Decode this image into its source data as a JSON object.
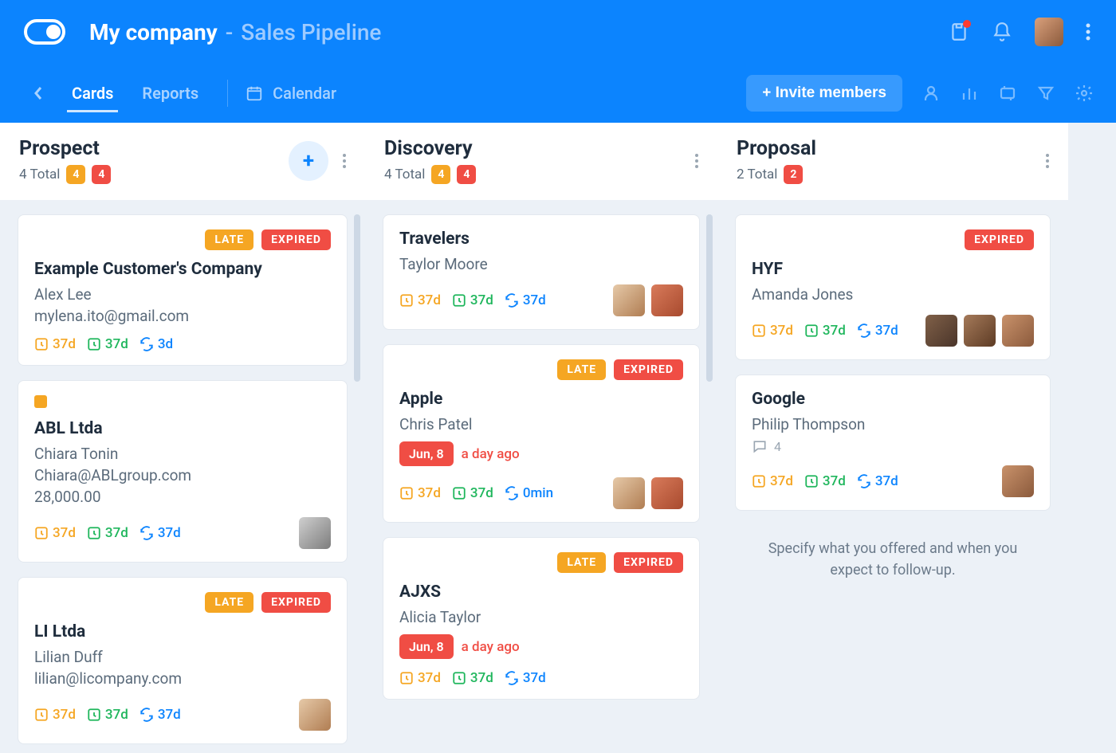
{
  "header": {
    "company": "My company",
    "page": "Sales Pipeline"
  },
  "tabs": {
    "cards": "Cards",
    "reports": "Reports",
    "calendar": "Calendar"
  },
  "invite_label": "+ Invite members",
  "columns": [
    {
      "title": "Prospect",
      "total_label": "4 Total",
      "badges": [
        "4",
        "4"
      ],
      "has_add": true,
      "scroll_hint": true,
      "cards": [
        {
          "status": [
            "LATE",
            "EXPIRED"
          ],
          "title": "Example Customer's Company",
          "lines": [
            "Alex Lee",
            "mylena.ito@gmail.com"
          ],
          "timers": [
            {
              "color": "orange",
              "v": "37d"
            },
            {
              "color": "green",
              "v": "37d"
            },
            {
              "color": "blue",
              "v": "3d"
            }
          ],
          "avatars": []
        },
        {
          "small_box": true,
          "title": "ABL Ltda",
          "lines": [
            "Chiara Tonin",
            "Chiara@ABLgroup.com",
            "28,000.00"
          ],
          "timers": [
            {
              "color": "orange",
              "v": "37d"
            },
            {
              "color": "green",
              "v": "37d"
            },
            {
              "color": "blue",
              "v": "37d"
            }
          ],
          "avatars": [
            "av-3"
          ]
        },
        {
          "status": [
            "LATE",
            "EXPIRED"
          ],
          "title": "LI Ltda",
          "lines": [
            "Lilian Duff",
            "lilian@licompany.com"
          ],
          "timers": [
            {
              "color": "orange",
              "v": "37d"
            },
            {
              "color": "green",
              "v": "37d"
            },
            {
              "color": "blue",
              "v": "37d"
            }
          ],
          "avatars": [
            "av-1"
          ]
        }
      ]
    },
    {
      "title": "Discovery",
      "total_label": "4 Total",
      "badges": [
        "4",
        "4"
      ],
      "scroll_hint": true,
      "cards": [
        {
          "title": "Travelers",
          "lines": [
            "Taylor Moore"
          ],
          "timers": [
            {
              "color": "orange",
              "v": "37d"
            },
            {
              "color": "green",
              "v": "37d"
            },
            {
              "color": "blue",
              "v": "37d"
            }
          ],
          "avatars": [
            "av-1",
            "av-2"
          ]
        },
        {
          "status": [
            "LATE",
            "EXPIRED"
          ],
          "title": "Apple",
          "lines": [
            "Chris Patel"
          ],
          "date_chip": "Jun, 8",
          "date_ago": "a day ago",
          "timers": [
            {
              "color": "orange",
              "v": "37d"
            },
            {
              "color": "green",
              "v": "37d"
            },
            {
              "color": "blue",
              "v": "0min"
            }
          ],
          "avatars": [
            "av-1",
            "av-2"
          ]
        },
        {
          "status": [
            "LATE",
            "EXPIRED"
          ],
          "title": "AJXS",
          "lines": [
            "Alicia Taylor"
          ],
          "date_chip": "Jun, 8",
          "date_ago": "a day ago",
          "timers": [
            {
              "color": "orange",
              "v": "37d"
            },
            {
              "color": "green",
              "v": "37d"
            },
            {
              "color": "blue",
              "v": "37d"
            }
          ],
          "avatars": []
        }
      ]
    },
    {
      "title": "Proposal",
      "total_label": "2 Total",
      "badges": [
        "2"
      ],
      "cards": [
        {
          "status": [
            "EXPIRED"
          ],
          "title": "HYF",
          "lines": [
            "Amanda Jones"
          ],
          "timers": [
            {
              "color": "orange",
              "v": "37d"
            },
            {
              "color": "green",
              "v": "37d"
            },
            {
              "color": "blue",
              "v": "37d"
            }
          ],
          "avatars": [
            "av-4",
            "av-5",
            "av-6"
          ]
        },
        {
          "title": "Google",
          "lines": [
            "Philip Thompson"
          ],
          "comments": "4",
          "timers": [
            {
              "color": "orange",
              "v": "37d"
            },
            {
              "color": "green",
              "v": "37d"
            },
            {
              "color": "blue",
              "v": "37d"
            }
          ],
          "avatars": [
            "av-6"
          ]
        }
      ],
      "footer_text": "Specify what you offered and when you expect to follow-up."
    }
  ]
}
